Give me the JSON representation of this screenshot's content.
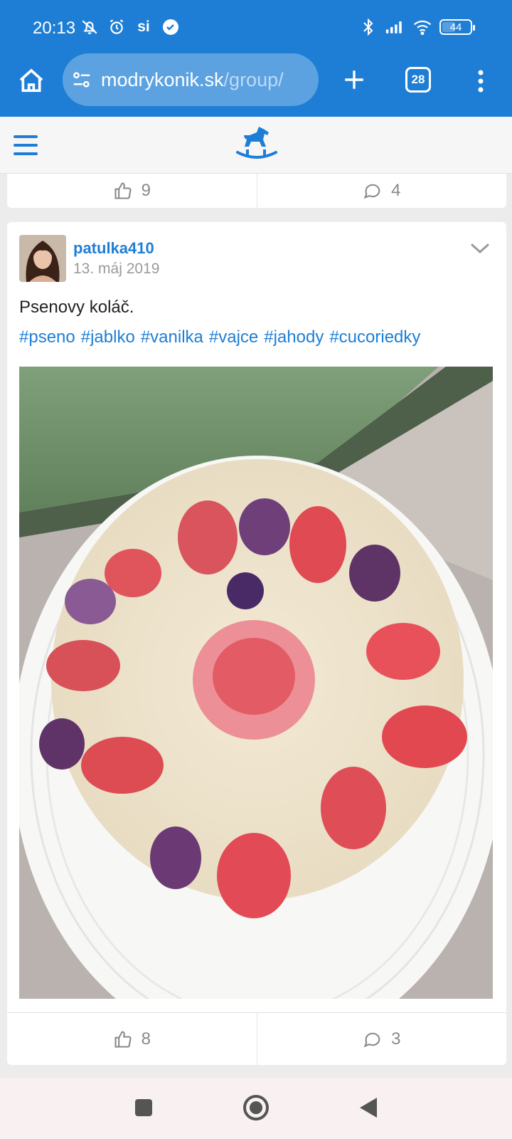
{
  "status_bar": {
    "time": "20:13",
    "battery": "44",
    "icons": [
      "mute-icon",
      "alarm-icon",
      "si-icon",
      "check-circle-icon",
      "bluetooth-icon",
      "signal-icon",
      "wifi-icon",
      "battery-icon"
    ]
  },
  "browser": {
    "url_host": "modrykonik.sk",
    "url_path": "/group/",
    "tab_count": "28",
    "accent": "#1e7ed6"
  },
  "previous_post": {
    "likes": "9",
    "comments": "4"
  },
  "post": {
    "author": "patulka410",
    "date": "13. máj 2019",
    "title": "Psenovy koláč.",
    "tags": [
      "#pseno",
      "#jablko",
      "#vanilka",
      "#vajce",
      "#jahody",
      "#cucoriedky"
    ],
    "likes": "8",
    "comments": "3"
  }
}
